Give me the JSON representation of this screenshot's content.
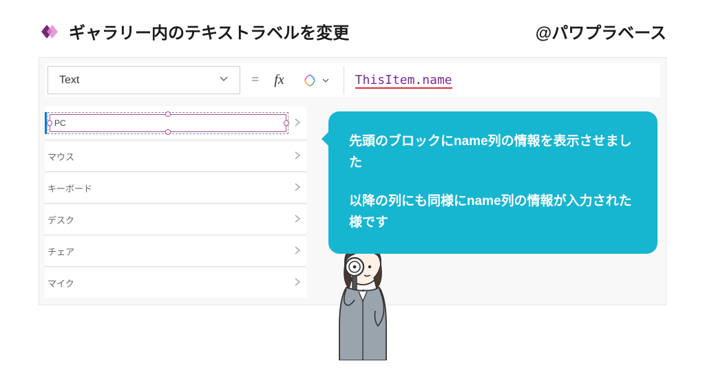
{
  "header": {
    "title": "ギャラリー内のテキストラベルを変更",
    "handle": "@パワプラベース"
  },
  "formula_bar": {
    "property": "Text",
    "equals": "=",
    "fx": "fx",
    "formula_object": "ThisItem",
    "formula_dot": ".",
    "formula_prop": "name"
  },
  "gallery": {
    "items": [
      {
        "label": "PC",
        "selected": true
      },
      {
        "label": "マウス",
        "selected": false
      },
      {
        "label": "キーボード",
        "selected": false
      },
      {
        "label": "デスク",
        "selected": false
      },
      {
        "label": "チェア",
        "selected": false
      },
      {
        "label": "マイク",
        "selected": false
      }
    ]
  },
  "speech": {
    "p1": "先頭のブロックにname列の情報を表示させました",
    "p2": "以降の列にも同様にname列の情報が入力された様です"
  }
}
